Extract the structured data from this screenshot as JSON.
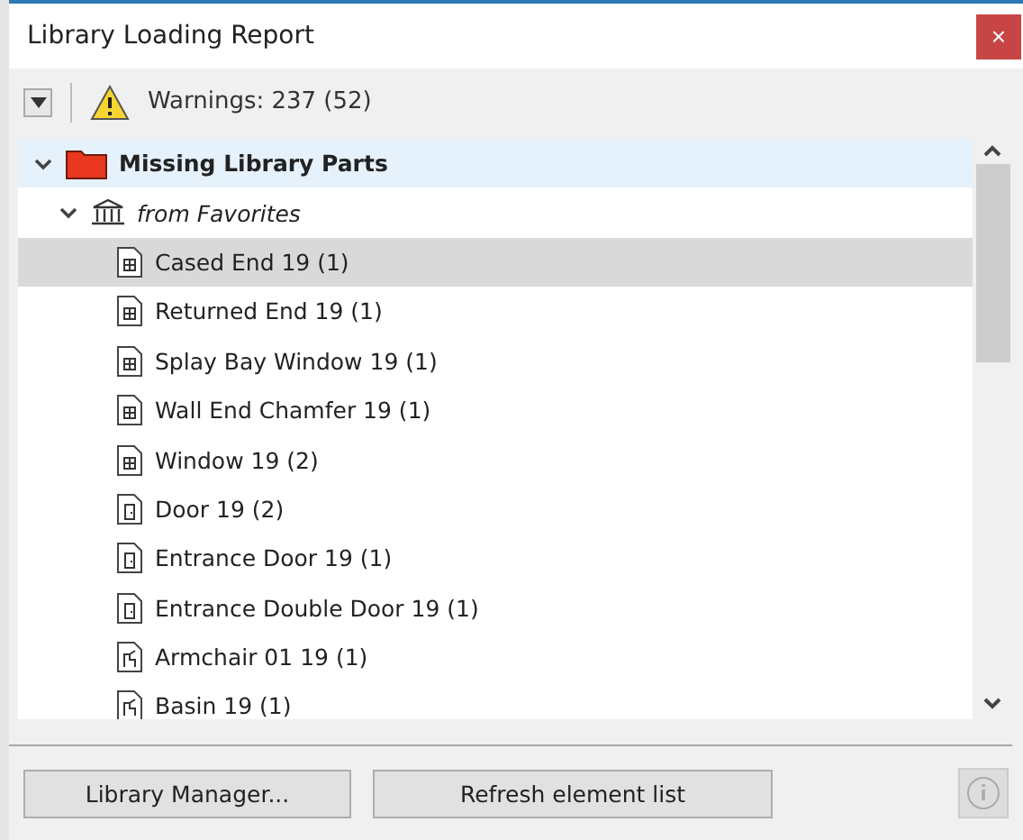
{
  "window": {
    "title": "Library Loading Report",
    "close": "×"
  },
  "toolbar": {
    "warnings": "Warnings: 237 (52)"
  },
  "tree": [
    {
      "label": "Missing Library Parts",
      "expanded": true,
      "selected": false,
      "children": [
        {
          "label": "from Favorites",
          "expanded": true,
          "selected": false,
          "children": [
            {
              "label": "Cased End 19 (1)",
              "kind": "window",
              "selected": true
            },
            {
              "label": "Returned End 19 (1)",
              "kind": "window",
              "selected": false
            },
            {
              "label": "Splay Bay Window 19 (1)",
              "kind": "window",
              "selected": false
            },
            {
              "label": "Wall End Chamfer 19 (1)",
              "kind": "window",
              "selected": false
            },
            {
              "label": "Window 19 (2)",
              "kind": "window",
              "selected": false
            },
            {
              "label": "Door 19 (2)",
              "kind": "door",
              "selected": false
            },
            {
              "label": "Entrance Door 19 (1)",
              "kind": "door",
              "selected": false
            },
            {
              "label": "Entrance Double Door 19 (1)",
              "kind": "door",
              "selected": false
            },
            {
              "label": "Armchair 01 19 (1)",
              "kind": "object",
              "selected": false
            },
            {
              "label": "Basin 19 (1)",
              "kind": "object",
              "selected": false
            }
          ]
        }
      ]
    }
  ],
  "buttons": [
    "Library Manager...",
    "Refresh element list"
  ]
}
